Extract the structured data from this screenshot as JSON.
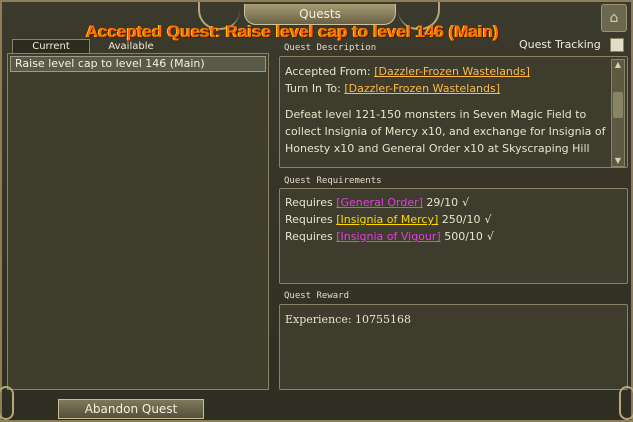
{
  "window": {
    "title": "Quests"
  },
  "announcement": "Accepted Quest: Raise level cap to level 146 (Main)",
  "tabs": {
    "current": "Current",
    "available": "Available"
  },
  "quest_list": [
    "Raise level cap to level 146 (Main)"
  ],
  "abandon_label": "Abandon Quest",
  "tracking": {
    "label": "Quest Tracking",
    "checked": false
  },
  "description": {
    "heading": "Quest Description",
    "accepted_from_label": "Accepted From:",
    "accepted_from": "[Dazzler-Frozen Wastelands]",
    "turn_in_label": "Turn In To:",
    "turn_in": "[Dazzler-Frozen Wastelands]",
    "body": "Defeat level 121-150 monsters in Seven Magic Field to collect Insignia of Mercy x10, and exchange for Insignia of Honesty x10 and General Order x10 at Skyscraping Hill"
  },
  "requirements": {
    "heading": "Quest Requirements",
    "items": [
      {
        "prefix": "Requires",
        "item": "[General Order]",
        "progress": "29/10",
        "mark": "√"
      },
      {
        "prefix": "Requires",
        "item": "[Insignia of Mercy]",
        "progress": "250/10",
        "mark": "√"
      },
      {
        "prefix": "Requires",
        "item": "[Insignia of Vigour]",
        "progress": "500/10",
        "mark": "√"
      }
    ]
  },
  "reward": {
    "heading": "Quest Reward",
    "text": "Experience: 10755168"
  },
  "colors": {
    "announcement": "#ff6a00",
    "npc_link": "#ffb84a",
    "item_link_a": "#e040e0",
    "item_link_b": "#ffd800"
  },
  "icons": {
    "basket": "basket-icon"
  }
}
